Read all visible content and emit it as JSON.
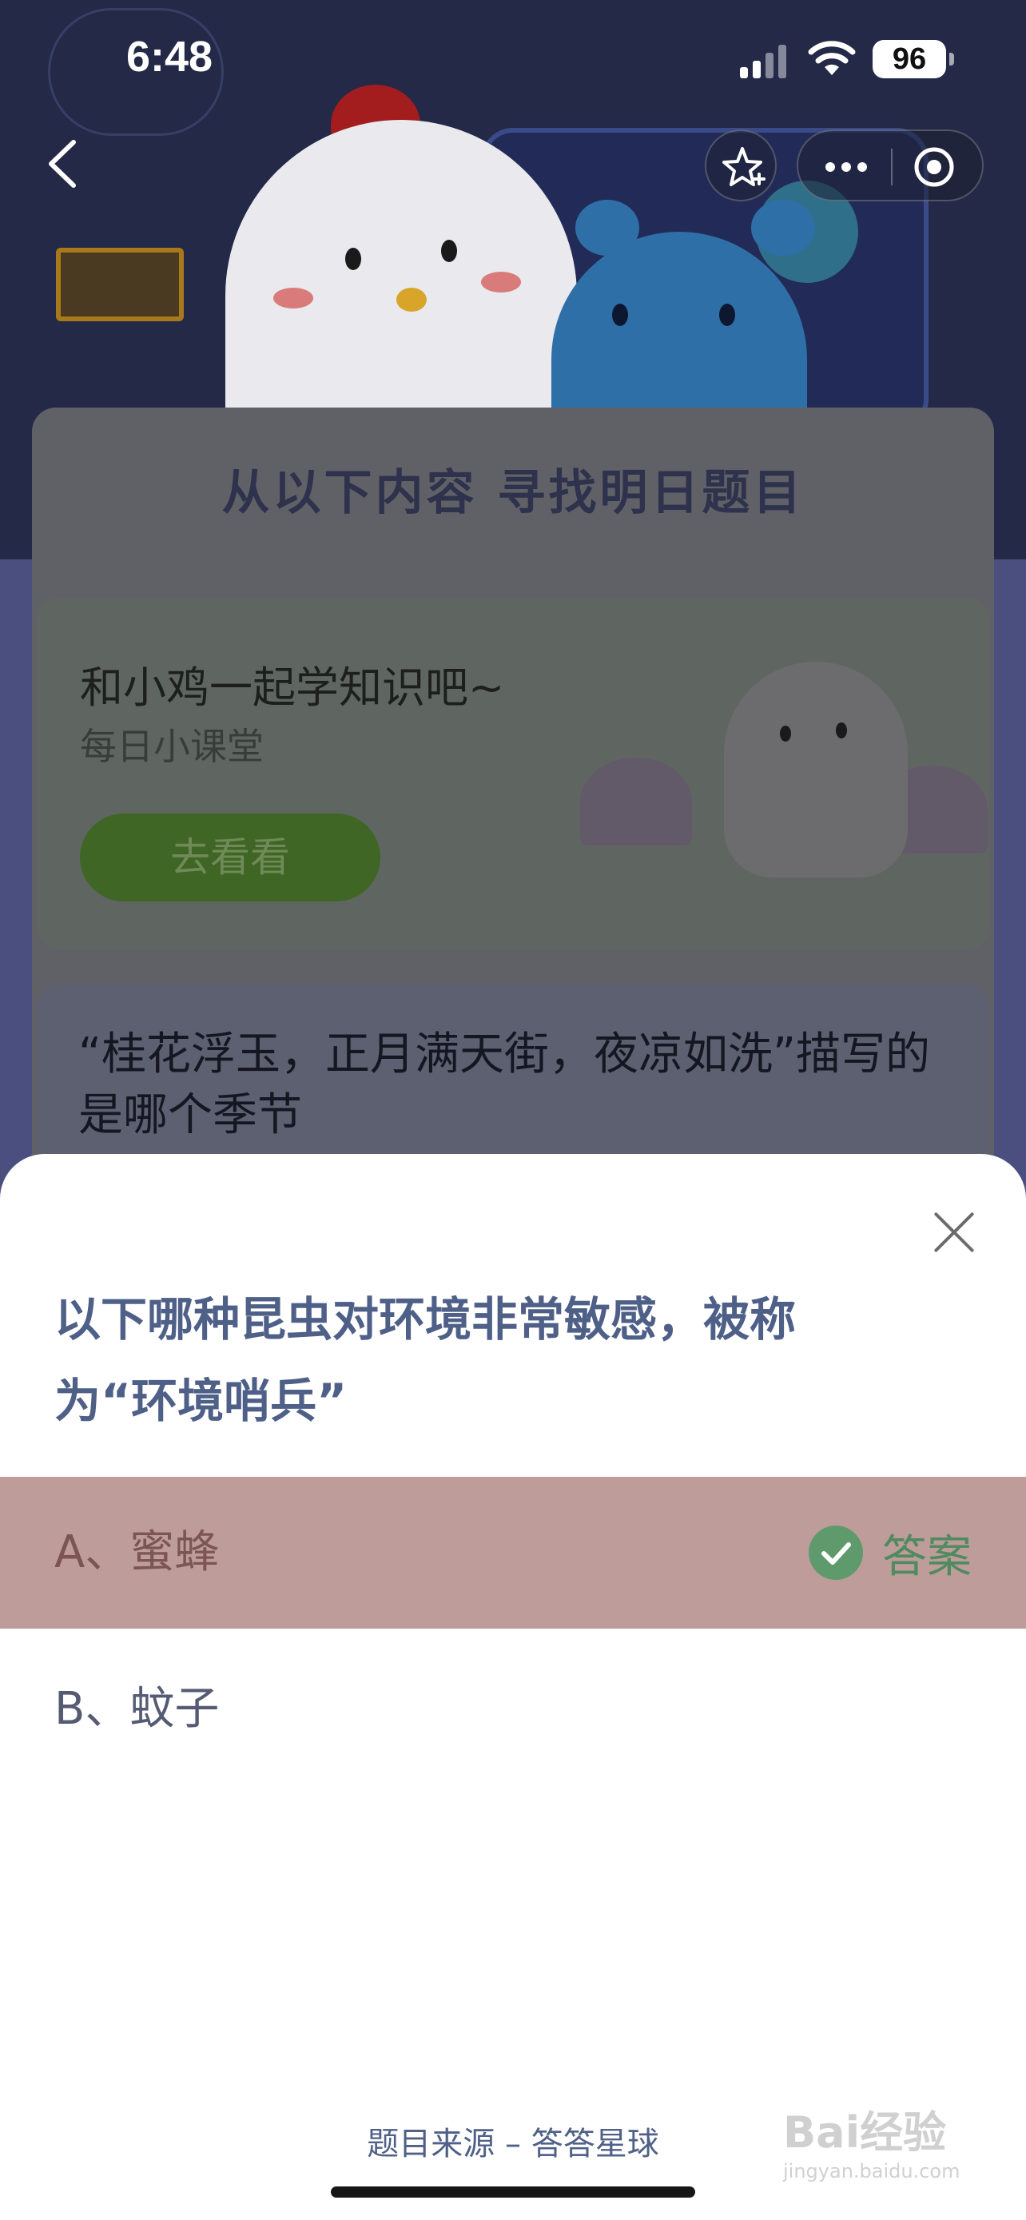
{
  "status_bar": {
    "time": "6:48",
    "battery": "96"
  },
  "nav": {
    "back_icon": "chevron-left-icon",
    "star_icon": "star-icon",
    "more_icon": "ellipsis-icon",
    "target_icon": "record-icon"
  },
  "background": {
    "section_title": "从以下内容 寻找明日题目",
    "lesson": {
      "title": "和小鸡一起学知识吧~",
      "subtitle": "每日小课堂",
      "button": "去看看"
    },
    "question_preview": "“桂花浮玉，正月满天街，夜凉如洗”描写的是哪个季节"
  },
  "sheet": {
    "question": "以下哪种昆虫对环境非常敏感，被称为“环境哨兵”",
    "options": [
      {
        "label": "A、蜜蜂",
        "is_answer": true,
        "badge": "答案"
      },
      {
        "label": "B、蚊子",
        "is_answer": false
      }
    ],
    "source": "题目来源 – 答答星球"
  },
  "watermark": {
    "brand": "Bai",
    "brand_suffix": "经验",
    "domain": "jingyan.baidu.com"
  },
  "colors": {
    "accent_blue": "#4f6088",
    "answer_green": "#5f9a6d",
    "correct_row": "#be9c9a"
  }
}
